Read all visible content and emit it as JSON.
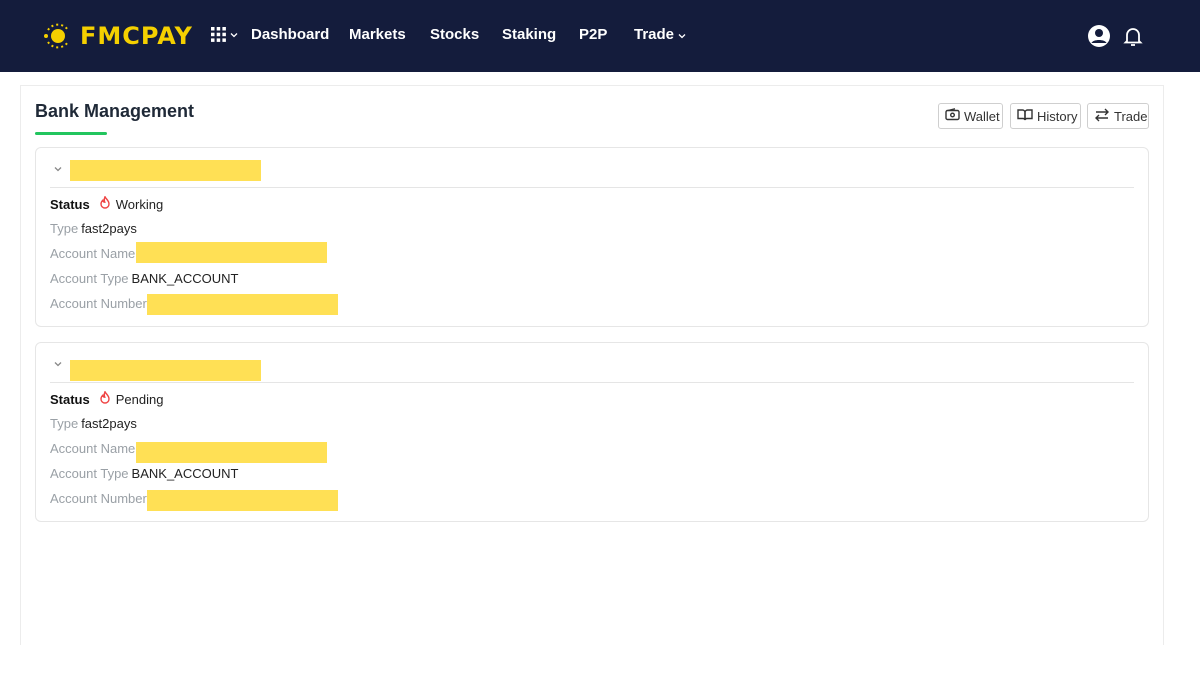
{
  "brand": {
    "name": "FMCPAY",
    "color": "#f5d000"
  },
  "nav": {
    "apps_icon": "grid-icon",
    "items": [
      {
        "label": "Dashboard"
      },
      {
        "label": "Markets"
      },
      {
        "label": "Stocks"
      },
      {
        "label": "Staking"
      },
      {
        "label": "P2P"
      },
      {
        "label": "Trade"
      }
    ],
    "user_icon": "user-circle-icon",
    "bell_icon": "bell-icon"
  },
  "page": {
    "title": "Bank Management",
    "accent": "#22c55e",
    "actions": [
      {
        "label": "Wallet",
        "icon": "wallet-icon"
      },
      {
        "label": "History",
        "icon": "book-icon"
      },
      {
        "label": "Trade",
        "icon": "swap-arrows-icon"
      }
    ]
  },
  "labels": {
    "status": "Status",
    "type": "Type",
    "account_name": "Account Name",
    "account_type": "Account Type",
    "account_number": "Account Number"
  },
  "accounts": [
    {
      "status": "Working",
      "type": "fast2pays",
      "account_type": "BANK_ACCOUNT"
    },
    {
      "status": "Pending",
      "type": "fast2pays",
      "account_type": "BANK_ACCOUNT"
    }
  ],
  "colors": {
    "topbar": "#141c3c",
    "redaction": "#ffe055",
    "status_icon": "#ef4444"
  }
}
